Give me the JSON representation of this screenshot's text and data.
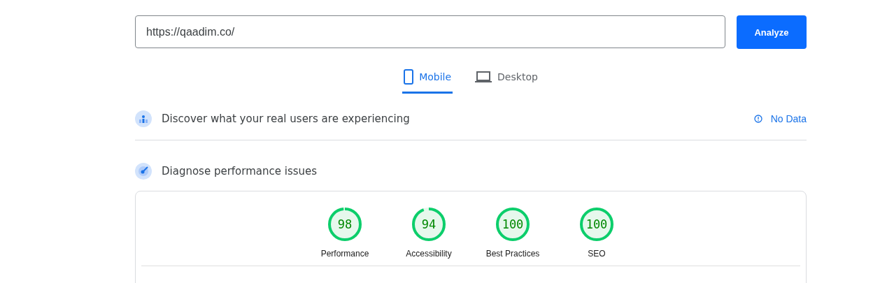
{
  "url_field": {
    "value": "https://qaadim.co/"
  },
  "analyze_button": {
    "label": "Analyze"
  },
  "tabs": [
    {
      "label": "Mobile",
      "kind": "mobile",
      "selected": true
    },
    {
      "label": "Desktop",
      "kind": "desktop",
      "selected": false
    }
  ],
  "field_data": {
    "title": "Discover what your real users are experiencing",
    "status": "No Data"
  },
  "lab_data": {
    "title": "Diagnose performance issues",
    "scores": [
      {
        "label": "Performance",
        "score": "98",
        "level": 0.98
      },
      {
        "label": "Accessibility",
        "score": "94",
        "level": 0.94
      },
      {
        "label": "Best Practices",
        "score": "100",
        "level": 1
      },
      {
        "label": "SEO",
        "score": "100",
        "level": 1
      }
    ]
  }
}
